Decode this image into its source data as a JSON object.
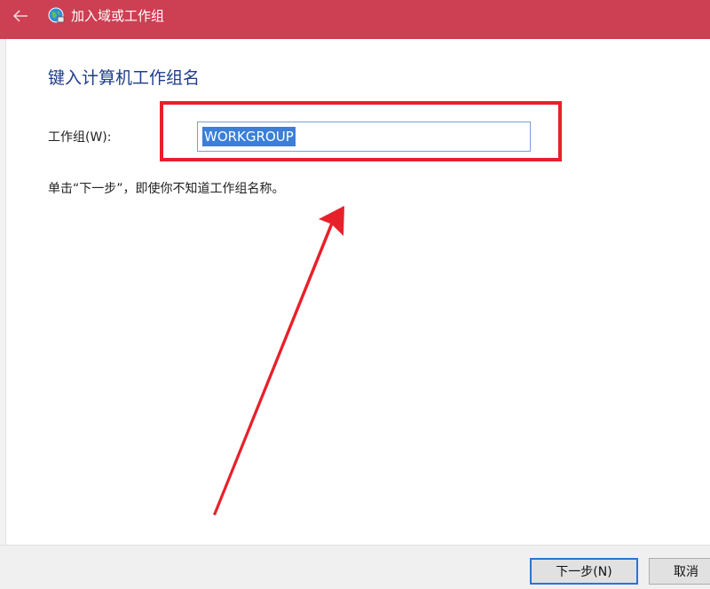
{
  "window": {
    "title": "加入域或工作组",
    "titlebar_color": "#cd3f52"
  },
  "icons": {
    "back": "back-arrow-icon",
    "app": "network-globe-icon"
  },
  "content": {
    "heading": "键入计算机工作组名",
    "workgroup_label": "工作组(W):",
    "workgroup_value": "WORKGROUP",
    "hint": "单击“下一步”，即使你不知道工作组名称。"
  },
  "annotation": {
    "color": "#e8202a"
  },
  "footer": {
    "next_label": "下一步(N)",
    "cancel_label": "取消"
  }
}
